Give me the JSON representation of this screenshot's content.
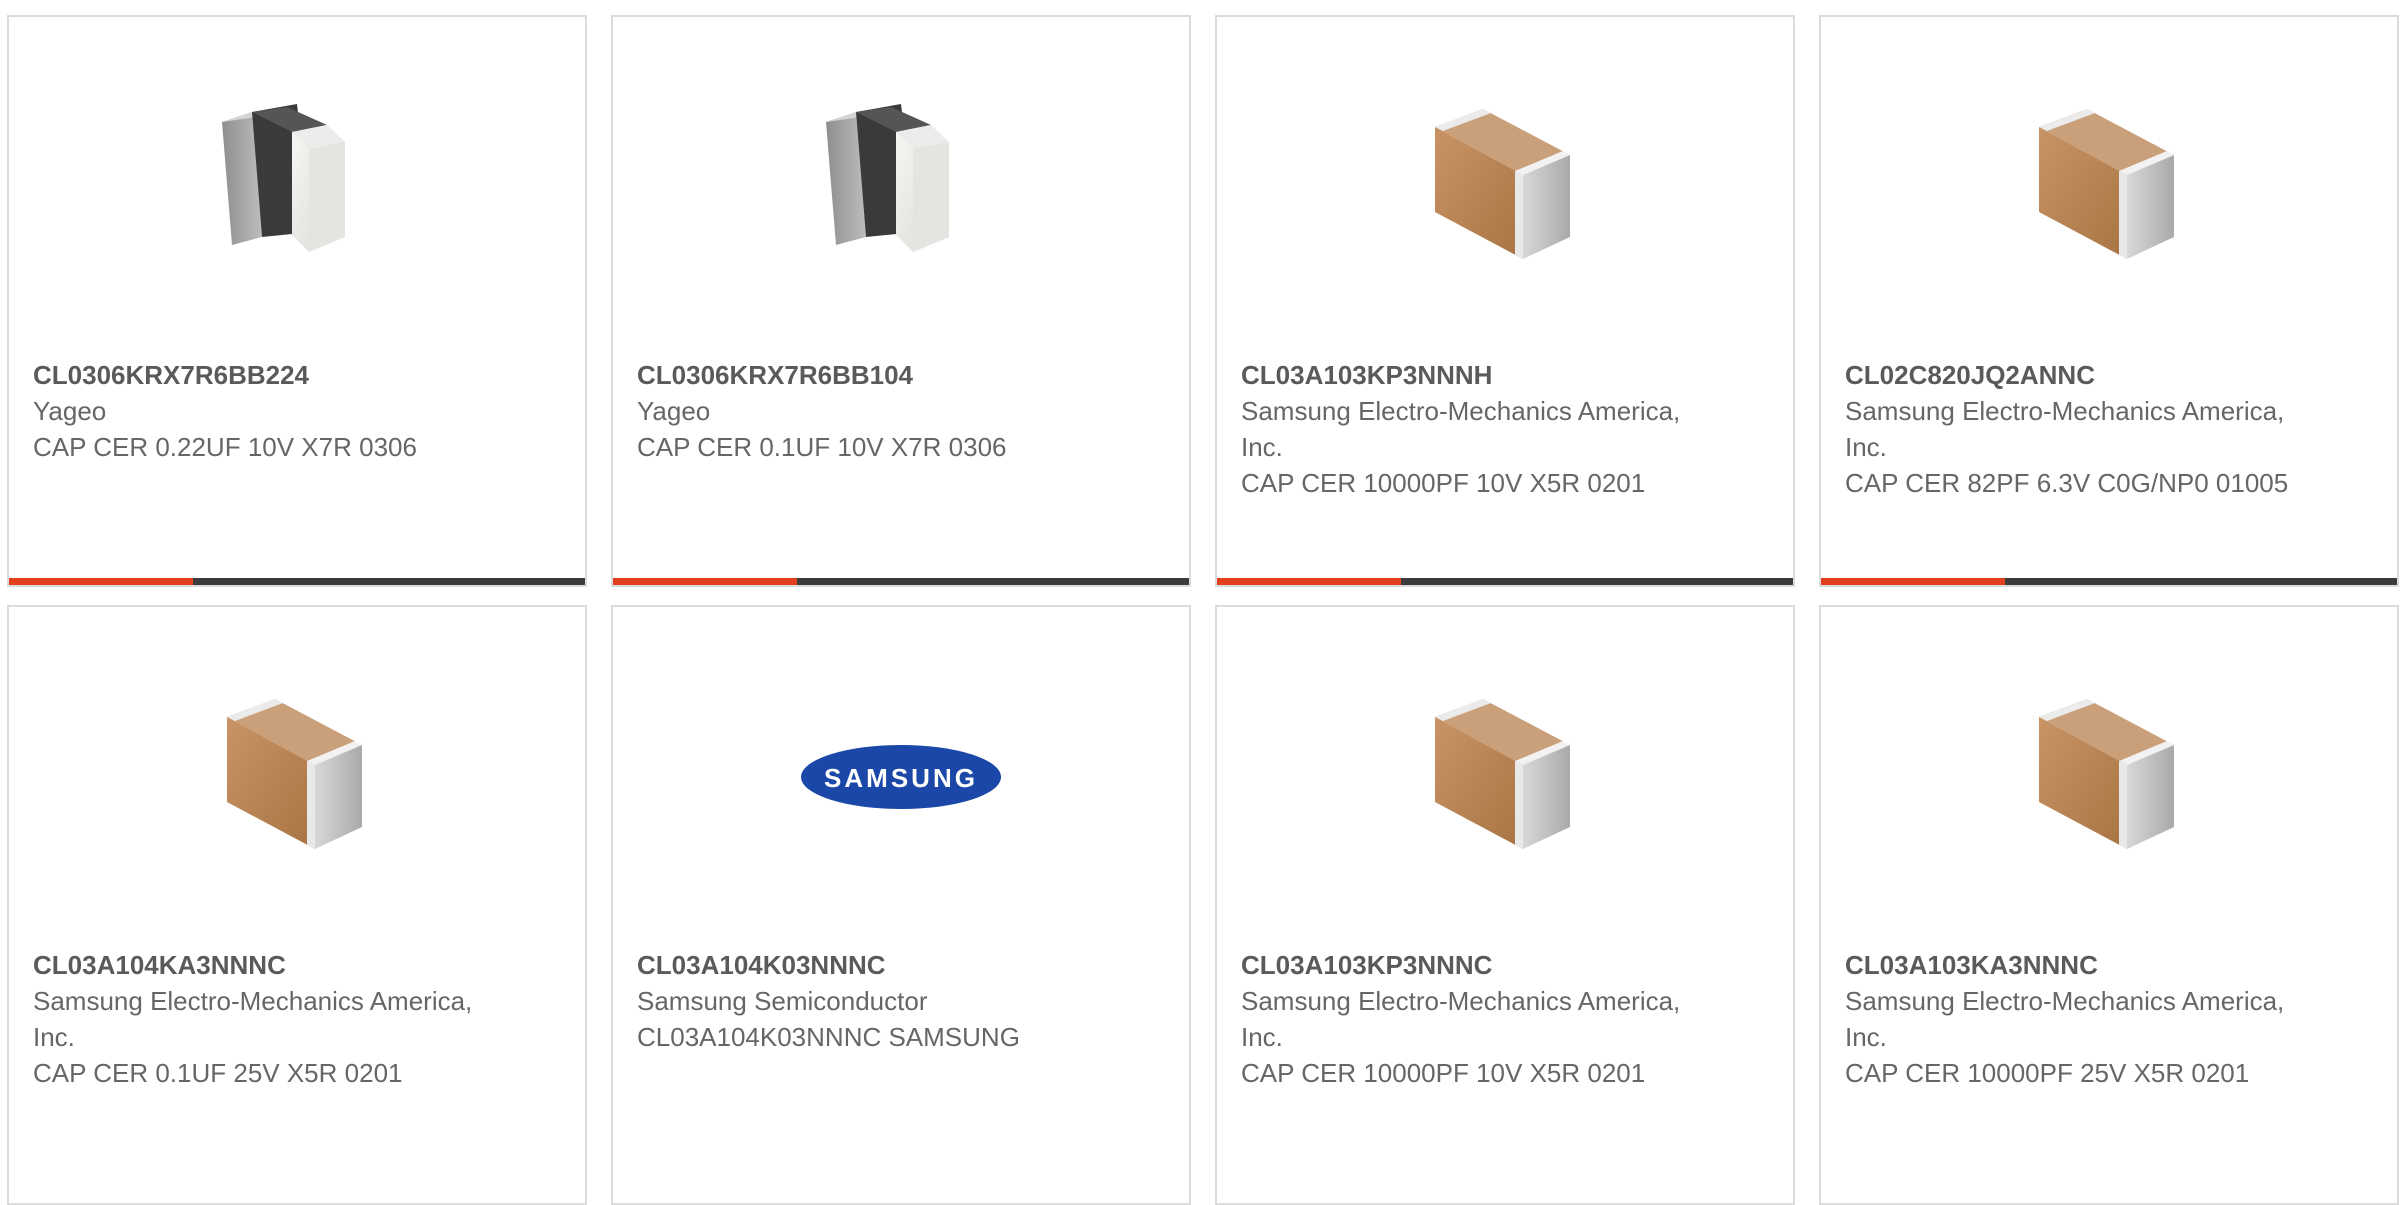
{
  "products": [
    {
      "part_number": "CL0306KRX7R6BB224",
      "manufacturer": "Yageo",
      "description": "CAP CER 0.22UF 10V X7R 0306",
      "image": "capacitor-dark-band-icon",
      "has_progress": true,
      "progress": 0.32
    },
    {
      "part_number": "CL0306KRX7R6BB104",
      "manufacturer": "Yageo",
      "description": "CAP CER 0.1UF 10V X7R 0306",
      "image": "capacitor-dark-band-icon",
      "has_progress": true,
      "progress": 0.32
    },
    {
      "part_number": "CL03A103KP3NNNH",
      "manufacturer": "Samsung Electro-Mechanics America, Inc.",
      "description": "CAP CER 10000PF 10V X5R 0201",
      "image": "capacitor-brown-icon",
      "has_progress": true,
      "progress": 0.32
    },
    {
      "part_number": "CL02C820JQ2ANNC",
      "manufacturer": "Samsung Electro-Mechanics America, Inc.",
      "description": "CAP CER 82PF 6.3V C0G/NP0 01005",
      "image": "capacitor-brown-icon",
      "has_progress": true,
      "progress": 0.32
    },
    {
      "part_number": "CL03A104KA3NNNC",
      "manufacturer": "Samsung Electro-Mechanics America, Inc.",
      "description": "CAP CER 0.1UF 25V X5R 0201",
      "image": "capacitor-brown-icon",
      "has_progress": false
    },
    {
      "part_number": "CL03A104K03NNNC",
      "manufacturer": "Samsung Semiconductor",
      "description": "CL03A104K03NNNC SAMSUNG",
      "image": "samsung-logo",
      "logo_text": "SAMSUNG",
      "has_progress": false
    },
    {
      "part_number": "CL03A103KP3NNNC",
      "manufacturer": "Samsung Electro-Mechanics America, Inc.",
      "description": "CAP CER 10000PF 10V X5R 0201",
      "image": "capacitor-brown-icon",
      "has_progress": false
    },
    {
      "part_number": "CL03A103KA3NNNC",
      "manufacturer": "Samsung Electro-Mechanics America, Inc.",
      "description": "CAP CER 10000PF 25V X5R 0201",
      "image": "capacitor-brown-icon",
      "has_progress": false
    }
  ],
  "colors": {
    "progress_fill": "#e2401c",
    "progress_track": "#3c3c3c",
    "card_border": "#dcdcdc",
    "text": "#666666"
  }
}
